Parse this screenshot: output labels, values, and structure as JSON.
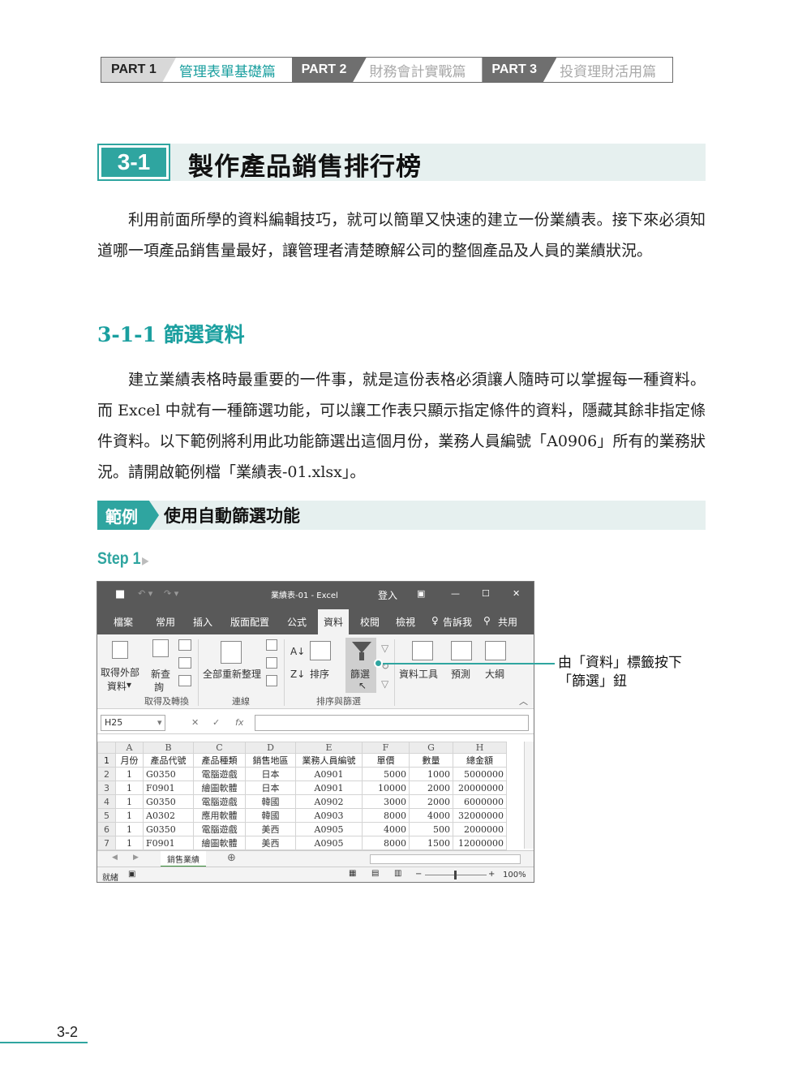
{
  "header": {
    "parts": [
      {
        "num": "PART 1",
        "title": "管理表單基礎篇",
        "active": true
      },
      {
        "num": "PART 2",
        "title": "財務會計實戰篇",
        "active": false
      },
      {
        "num": "PART 3",
        "title": "投資理財活用篇",
        "active": false
      }
    ]
  },
  "section": {
    "number": "3-1",
    "title": "製作產品銷售排行榜"
  },
  "intro": "利用前面所學的資料編輯技巧，就可以簡單又快速的建立一份業績表。接下來必須知道哪一項產品銷售量最好，讓管理者清楚瞭解公司的整個產品及人員的業績狀況。",
  "subsection": {
    "number": "3-1-1",
    "title": "篩選資料"
  },
  "body": "建立業績表格時最重要的一件事，就是這份表格必須讓人隨時可以掌握每一種資料。而 Excel 中就有一種篩選功能，可以讓工作表只顯示指定條件的資料，隱藏其餘非指定條件資料。以下範例將利用此功能篩選出這個月份，業務人員編號「A0906」所有的業務狀況。請開啟範例檔「業績表-01.xlsx」。",
  "example": {
    "tag": "範例",
    "title": "使用自動篩選功能"
  },
  "step": {
    "label": "Step 1",
    "arrow": "▶"
  },
  "excel": {
    "window_title": "業績表-01 - Excel",
    "login": "登入",
    "tabs": [
      "檔案",
      "常用",
      "插入",
      "版面配置",
      "公式",
      "資料",
      "校閱",
      "檢視",
      "告訴我",
      "共用"
    ],
    "ribbon": {
      "get_external": "取得外部",
      "get_external_2": "資料",
      "new_query": "新查",
      "new_query_2": "詢",
      "refresh_all": "全部重新整理",
      "sort": "排序",
      "filter": "篩選",
      "data_tools": "資料工具",
      "forecast": "預測",
      "outline": "大綱",
      "groups": [
        "取得及轉換",
        "連線",
        "排序與篩選"
      ]
    },
    "name_box": "H25",
    "fx": "fx",
    "columns": [
      "A",
      "B",
      "C",
      "D",
      "E",
      "F",
      "G",
      "H"
    ],
    "headers": [
      "月份",
      "產品代號",
      "產品種類",
      "銷售地區",
      "業務人員編號",
      "單價",
      "數量",
      "總金額"
    ],
    "rows": [
      [
        "1",
        "G0350",
        "電腦遊戲",
        "日本",
        "A0901",
        "5000",
        "1000",
        "5000000"
      ],
      [
        "1",
        "F0901",
        "繪圖軟體",
        "日本",
        "A0901",
        "10000",
        "2000",
        "20000000"
      ],
      [
        "1",
        "G0350",
        "電腦遊戲",
        "韓國",
        "A0902",
        "3000",
        "2000",
        "6000000"
      ],
      [
        "1",
        "A0302",
        "應用軟體",
        "韓國",
        "A0903",
        "8000",
        "4000",
        "32000000"
      ],
      [
        "1",
        "G0350",
        "電腦遊戲",
        "美西",
        "A0905",
        "4000",
        "500",
        "2000000"
      ],
      [
        "1",
        "F0901",
        "繪圖軟體",
        "美西",
        "A0905",
        "8000",
        "1500",
        "12000000"
      ]
    ],
    "row_numbers": [
      "1",
      "2",
      "3",
      "4",
      "5",
      "6",
      "7"
    ],
    "sheet_tab": "銷售業績",
    "status": "就緒",
    "zoom": "100%"
  },
  "callout": {
    "line1": "由「資料」標籤按下",
    "line2": "「篩選」鈕"
  },
  "page_number": "3-2",
  "colors": {
    "accent": "#2fa5a0",
    "bar_bg": "#e6f0ef",
    "excel_dark": "#595959"
  }
}
